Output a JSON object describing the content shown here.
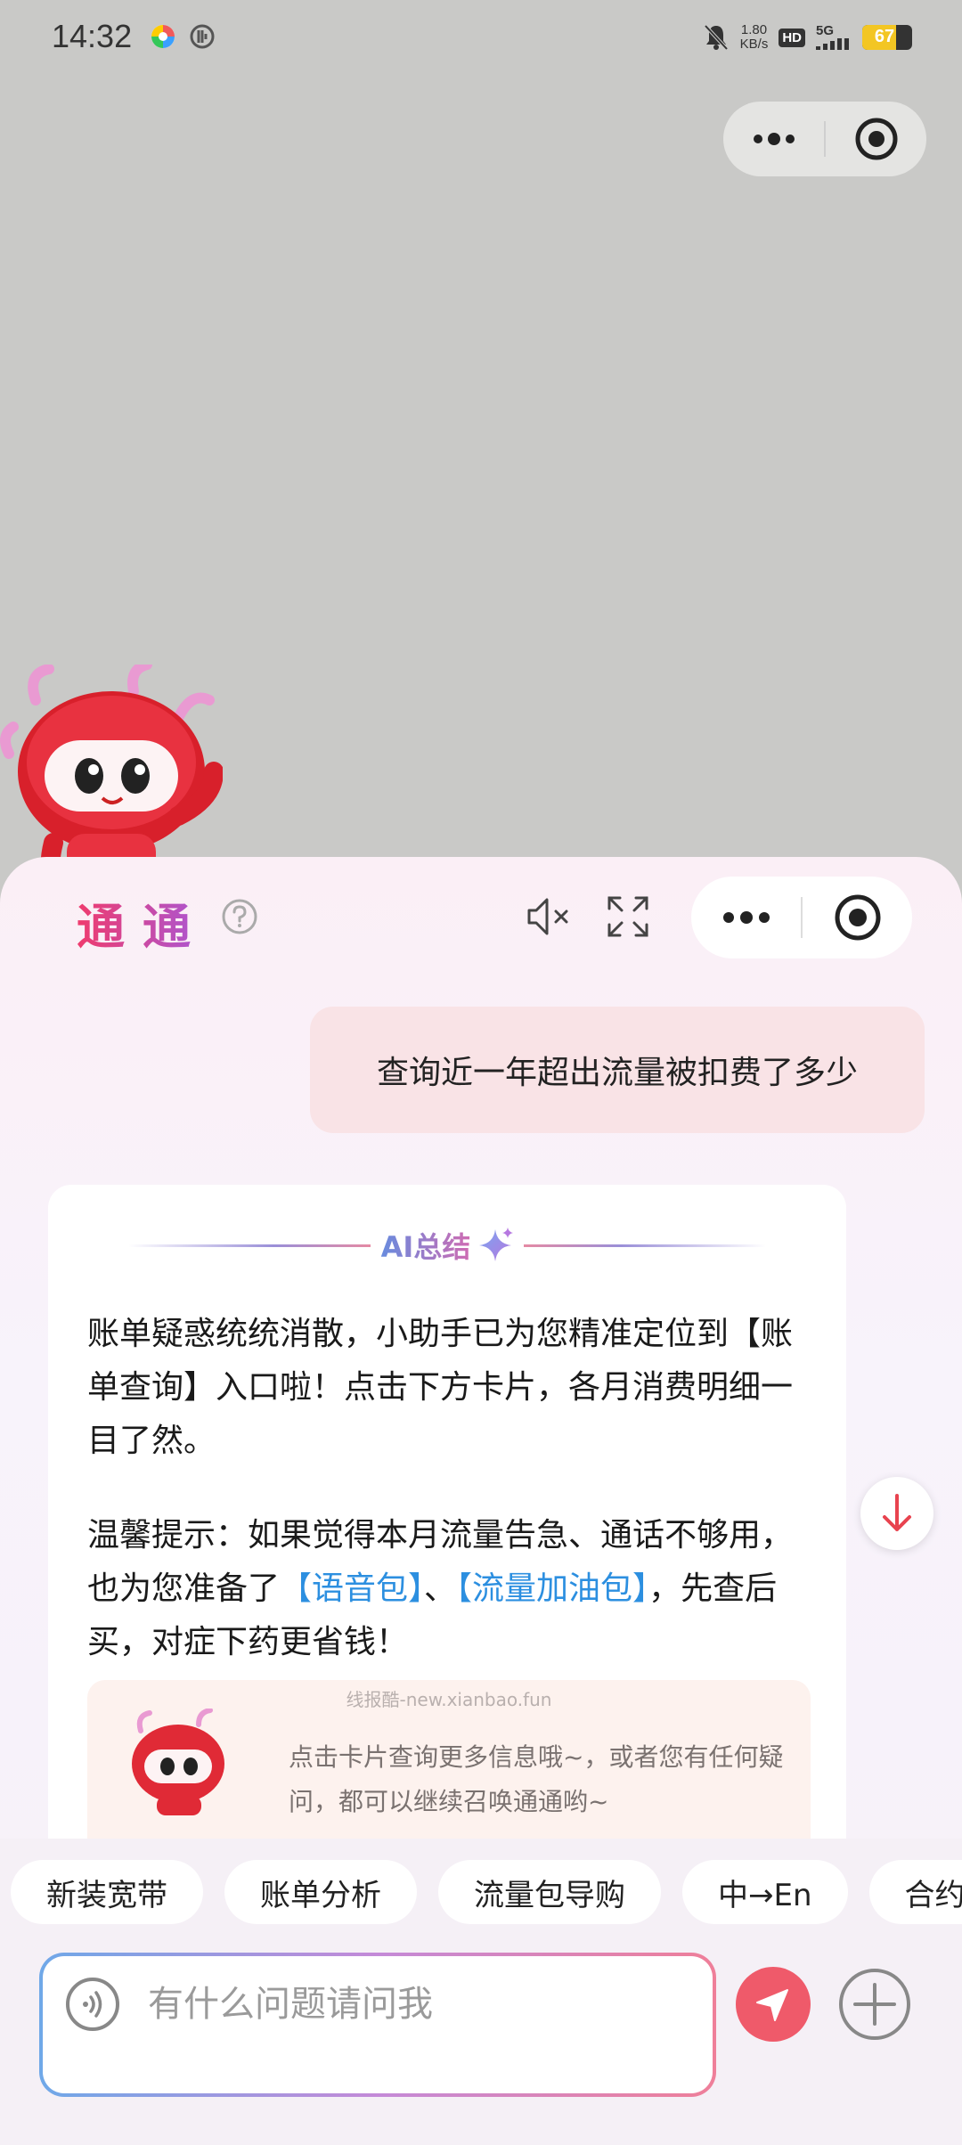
{
  "status_bar": {
    "time": "14:32",
    "net_speed_value": "1.80",
    "net_speed_unit": "KB/s",
    "hd_label": "HD",
    "network_label": "5G",
    "battery_percent": 67,
    "battery_label": "67"
  },
  "panel": {
    "brand": "通通",
    "user_message": "查询近一年超出流量被扣费了多少",
    "ai_card": {
      "title": "AI总结",
      "para1": "账单疑惑统统消散，小助手已为您精准定位到【账单查询】入口啦！点击下方卡片，各月消费明细一目了然。",
      "para2_prefix": "温馨提示：如果觉得本月流量告急、通话不够用，也为您准备了",
      "link_voice": "【语音包】",
      "para2_sep": "、",
      "link_data": "【流量加油包】",
      "para2_suffix": "，先查后买，对症下药更省钱！",
      "watermark": "线报酷-new.xianbao.fun",
      "sub_card_text": "点击卡片查询更多信息哦~，或者您有任何疑问，都可以继续召唤通通哟~"
    }
  },
  "quick_chips": [
    "新装宽带",
    "账单分析",
    "流量包导购",
    "中→En",
    "合约"
  ],
  "input": {
    "placeholder": "有什么问题请问我",
    "value": ""
  },
  "colors": {
    "accent_red": "#ef5a6a",
    "link_blue": "#2c8fe0",
    "brand_gradient_start": "#ef3b6d",
    "brand_gradient_end": "#a758d8"
  }
}
